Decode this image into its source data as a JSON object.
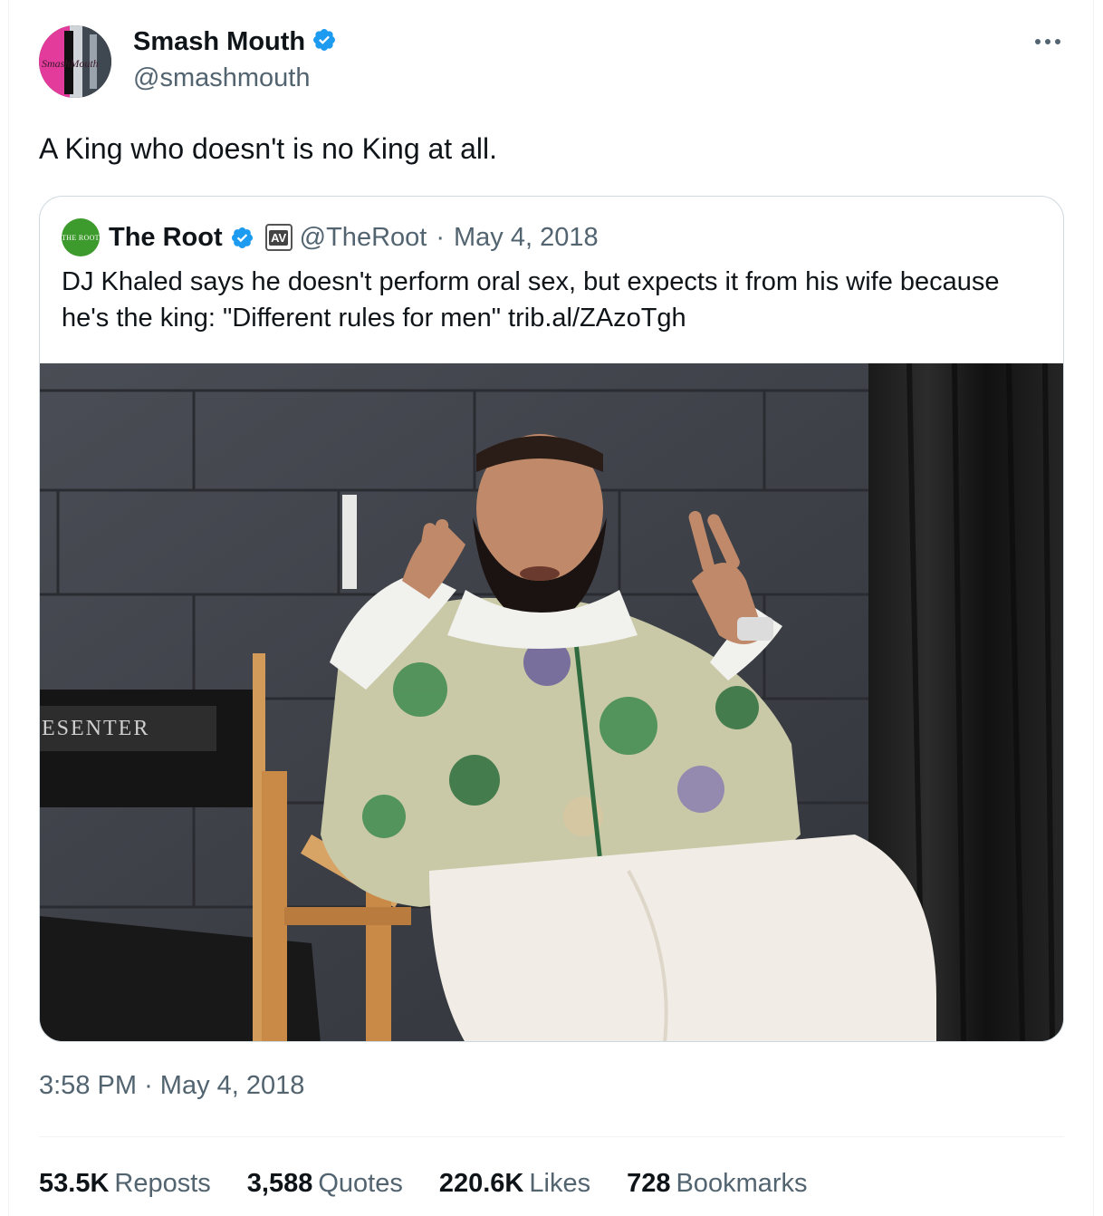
{
  "author": {
    "display_name": "Smash Mouth",
    "handle": "@smashmouth",
    "avatar_text": "SmashMouth",
    "verified_icon": "verified-badge-icon"
  },
  "tweet": {
    "text": "A King who doesn't is no King at all.",
    "time": "3:58 PM",
    "separator": "·",
    "date": "May 4, 2018"
  },
  "quoted": {
    "display_name": "The Root",
    "handle": "@TheRoot",
    "separator": "·",
    "date": "May 4, 2018",
    "avatar_text": "THE ROOT",
    "affiliation_text": "AV",
    "text": "DJ Khaled says he doesn't perform oral sex, but expects it from his wife because he's the king: \"Different rules for men\" trib.al/ZAzoTgh",
    "media_sign_text": "ESENTER"
  },
  "stats": [
    {
      "value": "53.5K",
      "label": "Reposts"
    },
    {
      "value": "3,588",
      "label": "Quotes"
    },
    {
      "value": "220.6K",
      "label": "Likes"
    },
    {
      "value": "728",
      "label": "Bookmarks"
    }
  ],
  "colors": {
    "accent_blue": "#1d9bf0",
    "secondary_text": "#536471",
    "root_green": "#3d9a2c"
  }
}
